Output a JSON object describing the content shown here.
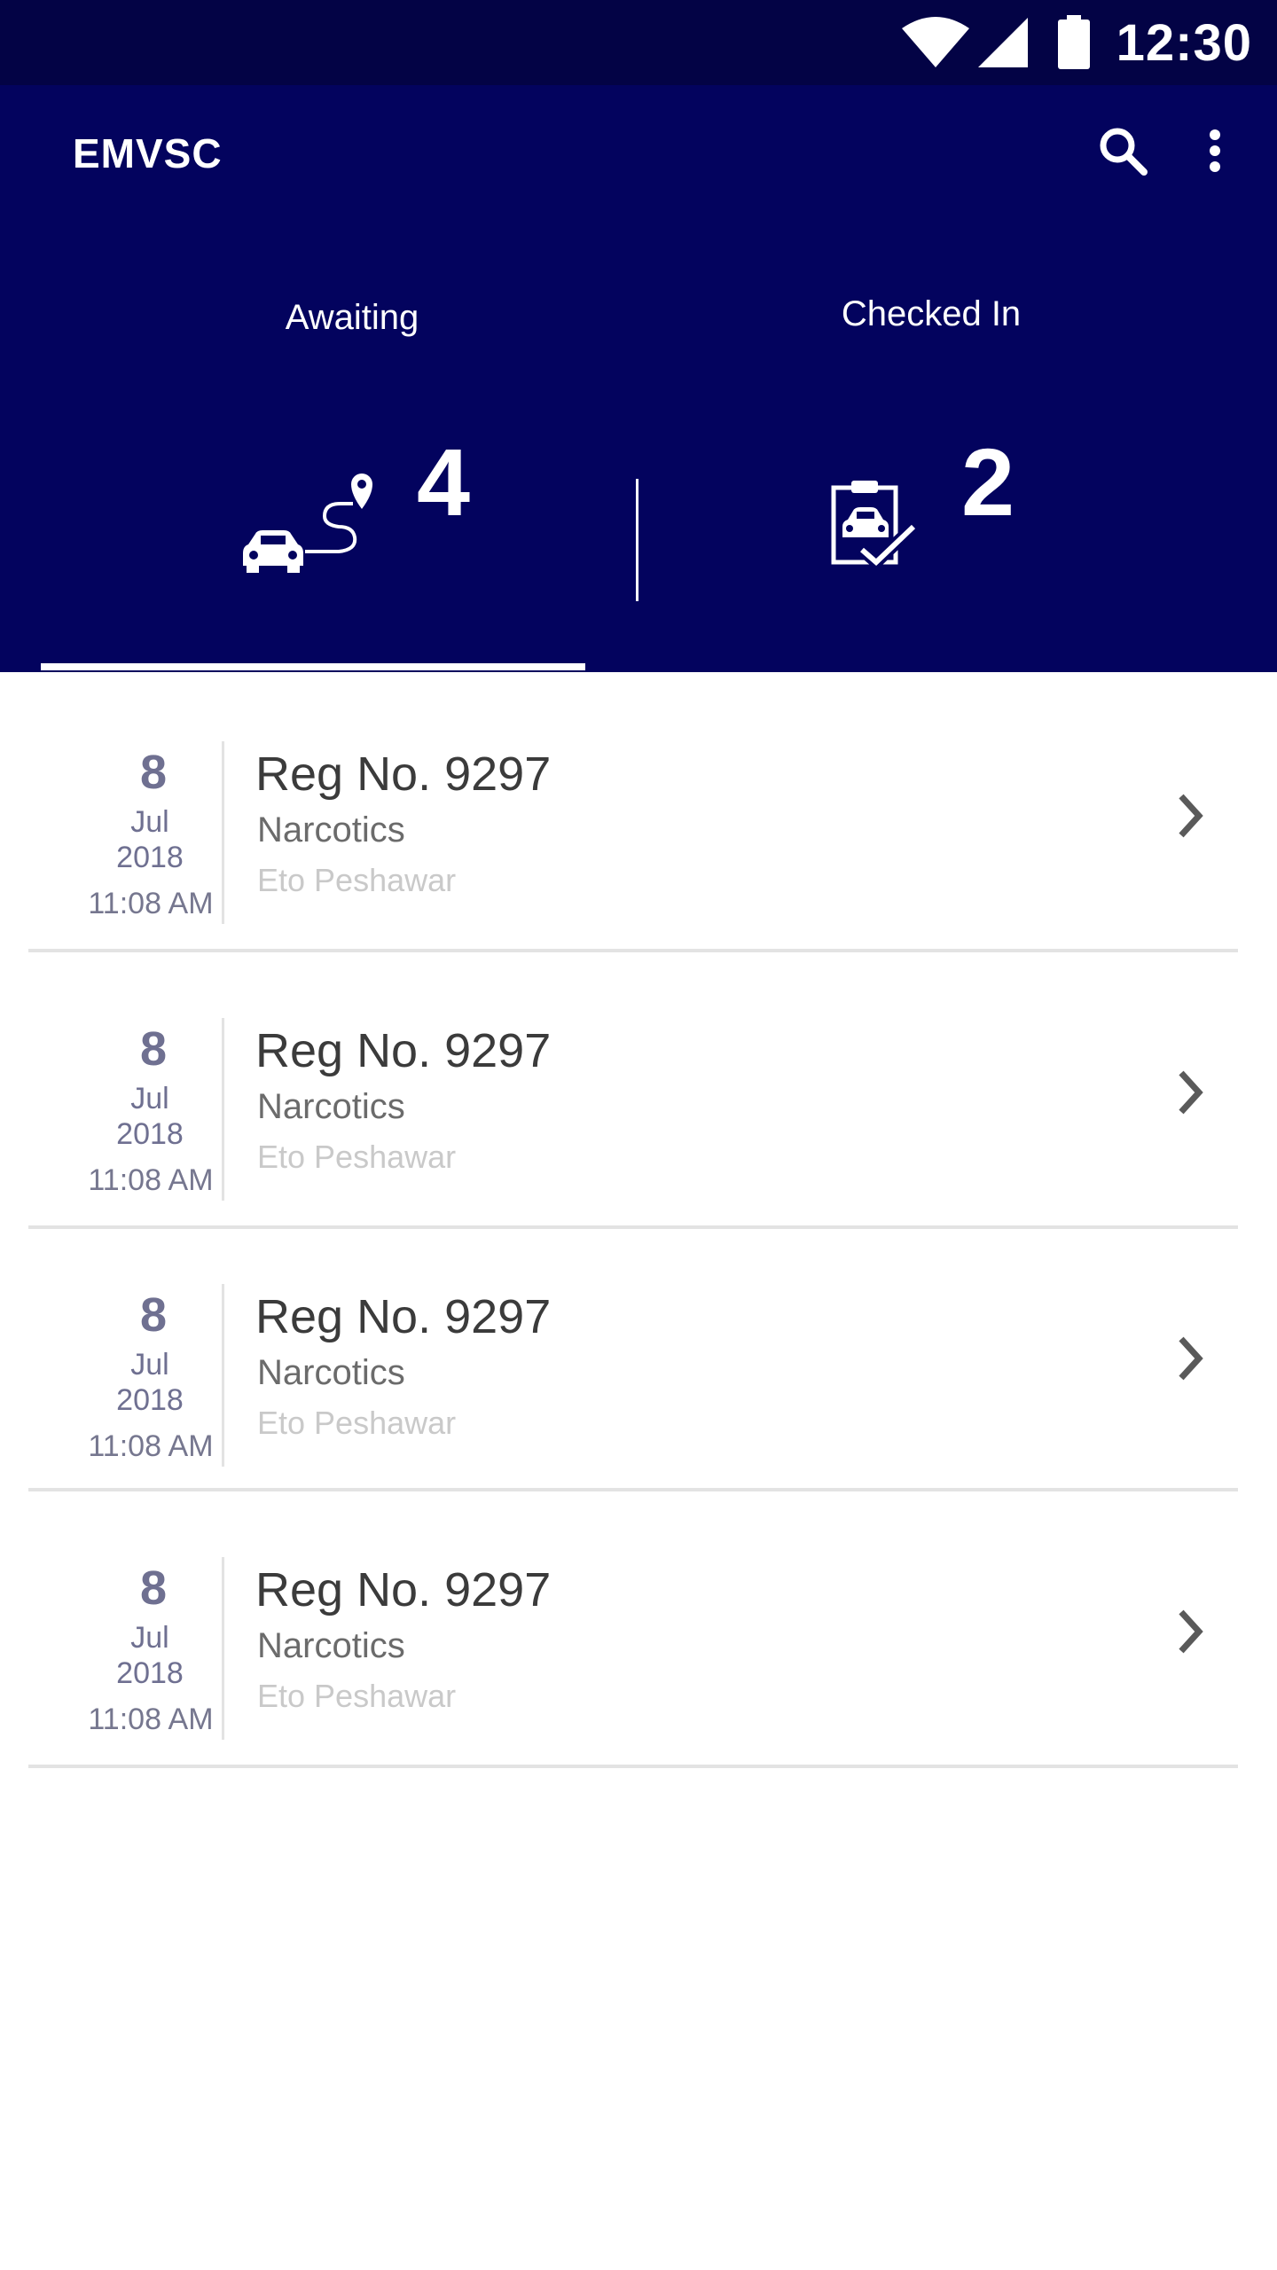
{
  "status_bar": {
    "time": "12:30",
    "icons": [
      "wifi-icon",
      "cell-signal-icon",
      "battery-icon"
    ]
  },
  "app": {
    "title": "EMVSC",
    "actions": [
      "search-icon",
      "more-vert-icon"
    ]
  },
  "stats": {
    "awaiting": {
      "label": "Awaiting",
      "value": "4",
      "icon": "car-route-icon"
    },
    "checked_in": {
      "label": "Checked In",
      "value": "2",
      "icon": "car-clipboard-check-icon"
    }
  },
  "active_tab": "Awaiting",
  "items": [
    {
      "day": "8",
      "month": "Jul",
      "year": "2018",
      "time": "11:08 AM",
      "reg": "Reg No. 9297",
      "category": "Narcotics",
      "location": "Eto Peshawar"
    },
    {
      "day": "8",
      "month": "Jul",
      "year": "2018",
      "time": "11:08 AM",
      "reg": "Reg No. 9297",
      "category": "Narcotics",
      "location": "Eto Peshawar"
    },
    {
      "day": "8",
      "month": "Jul",
      "year": "2018",
      "time": "11:08 AM",
      "reg": "Reg No. 9297",
      "category": "Narcotics",
      "location": "Eto Peshawar"
    },
    {
      "day": "8",
      "month": "Jul",
      "year": "2018",
      "time": "11:08 AM",
      "reg": "Reg No. 9297",
      "category": "Narcotics",
      "location": "Eto Peshawar"
    }
  ],
  "colors": {
    "status_bar": "#030345",
    "header": "#03035e",
    "date_text": "#6f7091"
  }
}
